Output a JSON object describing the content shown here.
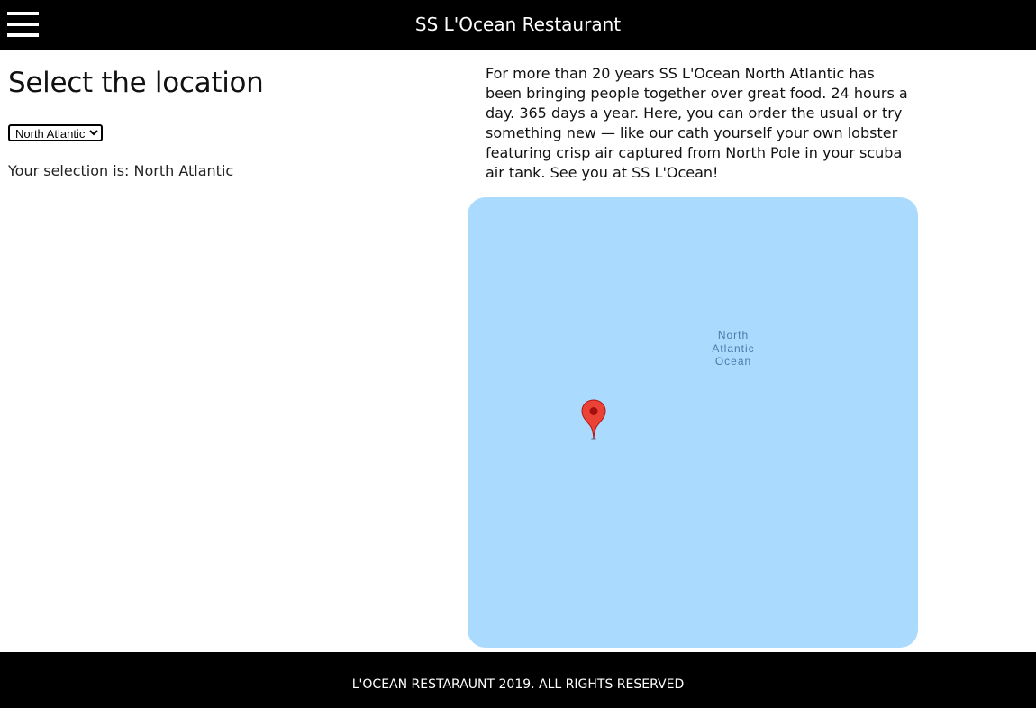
{
  "header": {
    "title": "SS L'Ocean Restaurant",
    "menu_icon": "hamburger-menu-icon"
  },
  "main": {
    "heading": "Select the location",
    "location_select": {
      "selected": "North Atlantic",
      "options": [
        "North Atlantic"
      ]
    },
    "selection_prefix": "Your selection is: ",
    "selection_value": "North Atlantic",
    "description": "For more than 20 years SS L'Ocean North Atlantic has been bringing people together over great food. 24 hours a day. 365 days a year. Here, you can order the usual or try something new — like our cath yourself your own lobster featuring crisp air captured from North Pole in your scuba air tank. See you at SS L'Ocean!"
  },
  "map": {
    "label_lines": [
      "North",
      "Atlantic",
      "Ocean"
    ],
    "water_color": "#abdaff",
    "marker_icon": "map-marker-icon",
    "marker_color": "#ea4335"
  },
  "footer": {
    "text": "L'OCEAN RESTARAUNT 2019. ALL RIGHTS RESERVED"
  }
}
